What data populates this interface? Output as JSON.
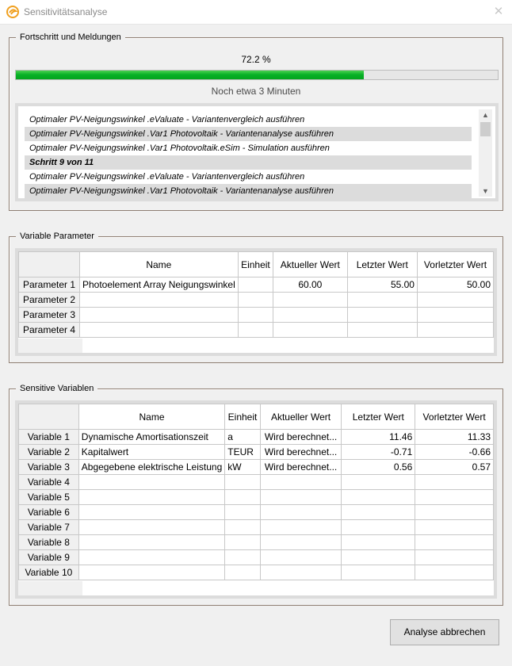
{
  "window": {
    "title": "Sensitivitätsanalyse",
    "app_icon": "easy-logo-icon",
    "close_icon": "close-icon"
  },
  "progress_group": {
    "title": "Fortschritt und Meldungen",
    "percent_text": "72.2 %",
    "progress_fraction": 0.722,
    "status_text": "Noch etwa 3 Minuten",
    "bar_color": "#06b025",
    "log": [
      {
        "text": "Optimaler PV-Neigungswinkel .eValuate - Variantenvergleich ausführen",
        "alt": false,
        "bold": false
      },
      {
        "text": "Optimaler PV-Neigungswinkel .Var1 Photovoltaik - Variantenanalyse ausführen",
        "alt": true,
        "bold": false
      },
      {
        "text": "Optimaler PV-Neigungswinkel .Var1 Photovoltaik.eSim - Simulation ausführen",
        "alt": false,
        "bold": false
      },
      {
        "text": "Schritt 9 von 11",
        "alt": true,
        "bold": true
      },
      {
        "text": "Optimaler PV-Neigungswinkel .eValuate - Variantenvergleich ausführen",
        "alt": false,
        "bold": false
      },
      {
        "text": "Optimaler PV-Neigungswinkel .Var1 Photovoltaik - Variantenanalyse ausführen",
        "alt": true,
        "bold": false
      }
    ]
  },
  "parameters": {
    "title": "Variable Parameter",
    "columns": [
      "Name",
      "Einheit",
      "Aktueller Wert",
      "Letzter Wert",
      "Vorletzter Wert"
    ],
    "rows": [
      {
        "label": "Parameter 1",
        "name": "Photoelement Array Neigungswinkel",
        "unit": "",
        "current": "60.00",
        "last": "55.00",
        "previous": "50.00"
      },
      {
        "label": "Parameter 2",
        "name": "",
        "unit": "",
        "current": "",
        "last": "",
        "previous": ""
      },
      {
        "label": "Parameter 3",
        "name": "",
        "unit": "",
        "current": "",
        "last": "",
        "previous": ""
      },
      {
        "label": "Parameter 4",
        "name": "",
        "unit": "",
        "current": "",
        "last": "",
        "previous": ""
      }
    ]
  },
  "variables": {
    "title": "Sensitive Variablen",
    "columns": [
      "Name",
      "Einheit",
      "Aktueller Wert",
      "Letzter Wert",
      "Vorletzter Wert"
    ],
    "rows": [
      {
        "label": "Variable 1",
        "name": "Dynamische Amortisationszeit",
        "unit": "a",
        "current": "Wird berechnet...",
        "last": "11.46",
        "previous": "11.33"
      },
      {
        "label": "Variable 2",
        "name": "Kapitalwert",
        "unit": "TEUR",
        "current": "Wird berechnet...",
        "last": "-0.71",
        "previous": "-0.66"
      },
      {
        "label": "Variable 3",
        "name": "Abgegebene elektrische Leistung",
        "unit": "kW",
        "current": "Wird berechnet...",
        "last": "0.56",
        "previous": "0.57"
      },
      {
        "label": "Variable 4",
        "name": "",
        "unit": "",
        "current": "",
        "last": "",
        "previous": ""
      },
      {
        "label": "Variable 5",
        "name": "",
        "unit": "",
        "current": "",
        "last": "",
        "previous": ""
      },
      {
        "label": "Variable 6",
        "name": "",
        "unit": "",
        "current": "",
        "last": "",
        "previous": ""
      },
      {
        "label": "Variable 7",
        "name": "",
        "unit": "",
        "current": "",
        "last": "",
        "previous": ""
      },
      {
        "label": "Variable 8",
        "name": "",
        "unit": "",
        "current": "",
        "last": "",
        "previous": ""
      },
      {
        "label": "Variable 9",
        "name": "",
        "unit": "",
        "current": "",
        "last": "",
        "previous": ""
      },
      {
        "label": "Variable 10",
        "name": "",
        "unit": "",
        "current": "",
        "last": "",
        "previous": ""
      }
    ]
  },
  "buttons": {
    "abort_label": "Analyse abbrechen"
  }
}
